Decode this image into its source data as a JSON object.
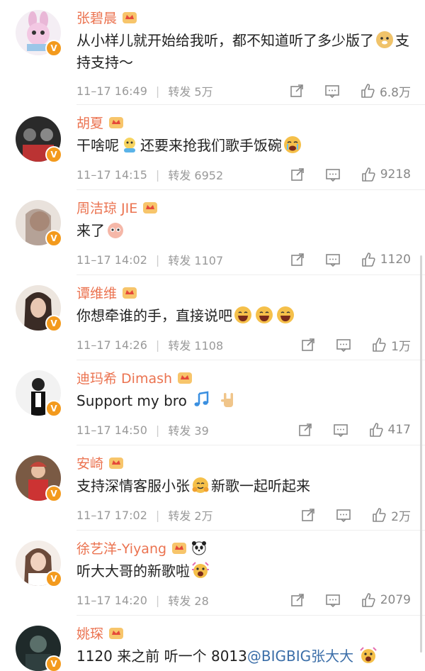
{
  "comments": [
    {
      "name": "张碧晨",
      "text": "从小样儿就开始给我听，都不知道听了多少版了",
      "text_after_emoji": "支持支持～",
      "time": "11–17 16:49",
      "repost": "转发 5万",
      "likes": "6.8万"
    },
    {
      "name": "胡夏",
      "text": "干啥呢",
      "text_after_emoji": "还要来抢我们歌手饭碗",
      "time": "11–17 14:15",
      "repost": "转发 6952",
      "likes": "9218"
    },
    {
      "name": "周洁琼 JIE",
      "text": "来了",
      "time": "11–17 14:02",
      "repost": "转发 1107",
      "likes": "1120"
    },
    {
      "name": "谭维维",
      "text": "你想牵谁的手，直接说吧",
      "time": "11–17 14:26",
      "repost": "转发 1108",
      "likes": "1万"
    },
    {
      "name": "迪玛希 Dimash",
      "text": "Support my bro",
      "time": "11–17 14:50",
      "repost": "转发 39",
      "likes": "417"
    },
    {
      "name": "安崎",
      "text": "支持深情客服小张",
      "text_after_emoji": "新歌一起听起来",
      "time": "11–17 17:02",
      "repost": "转发 2万",
      "likes": "2万"
    },
    {
      "name": "徐艺洋-Yiyang",
      "text": "听大大哥的新歌啦",
      "time": "11–17 14:20",
      "repost": "转发 28",
      "likes": "2079"
    },
    {
      "name": "姚琛",
      "text": "1120 来之前 听一个 8013",
      "mention": "@BIGBIG张大大"
    }
  ],
  "badge_letter": "V",
  "colors": {
    "name": "#eb7350",
    "badge": "#f39a1d",
    "meta": "#999999"
  }
}
